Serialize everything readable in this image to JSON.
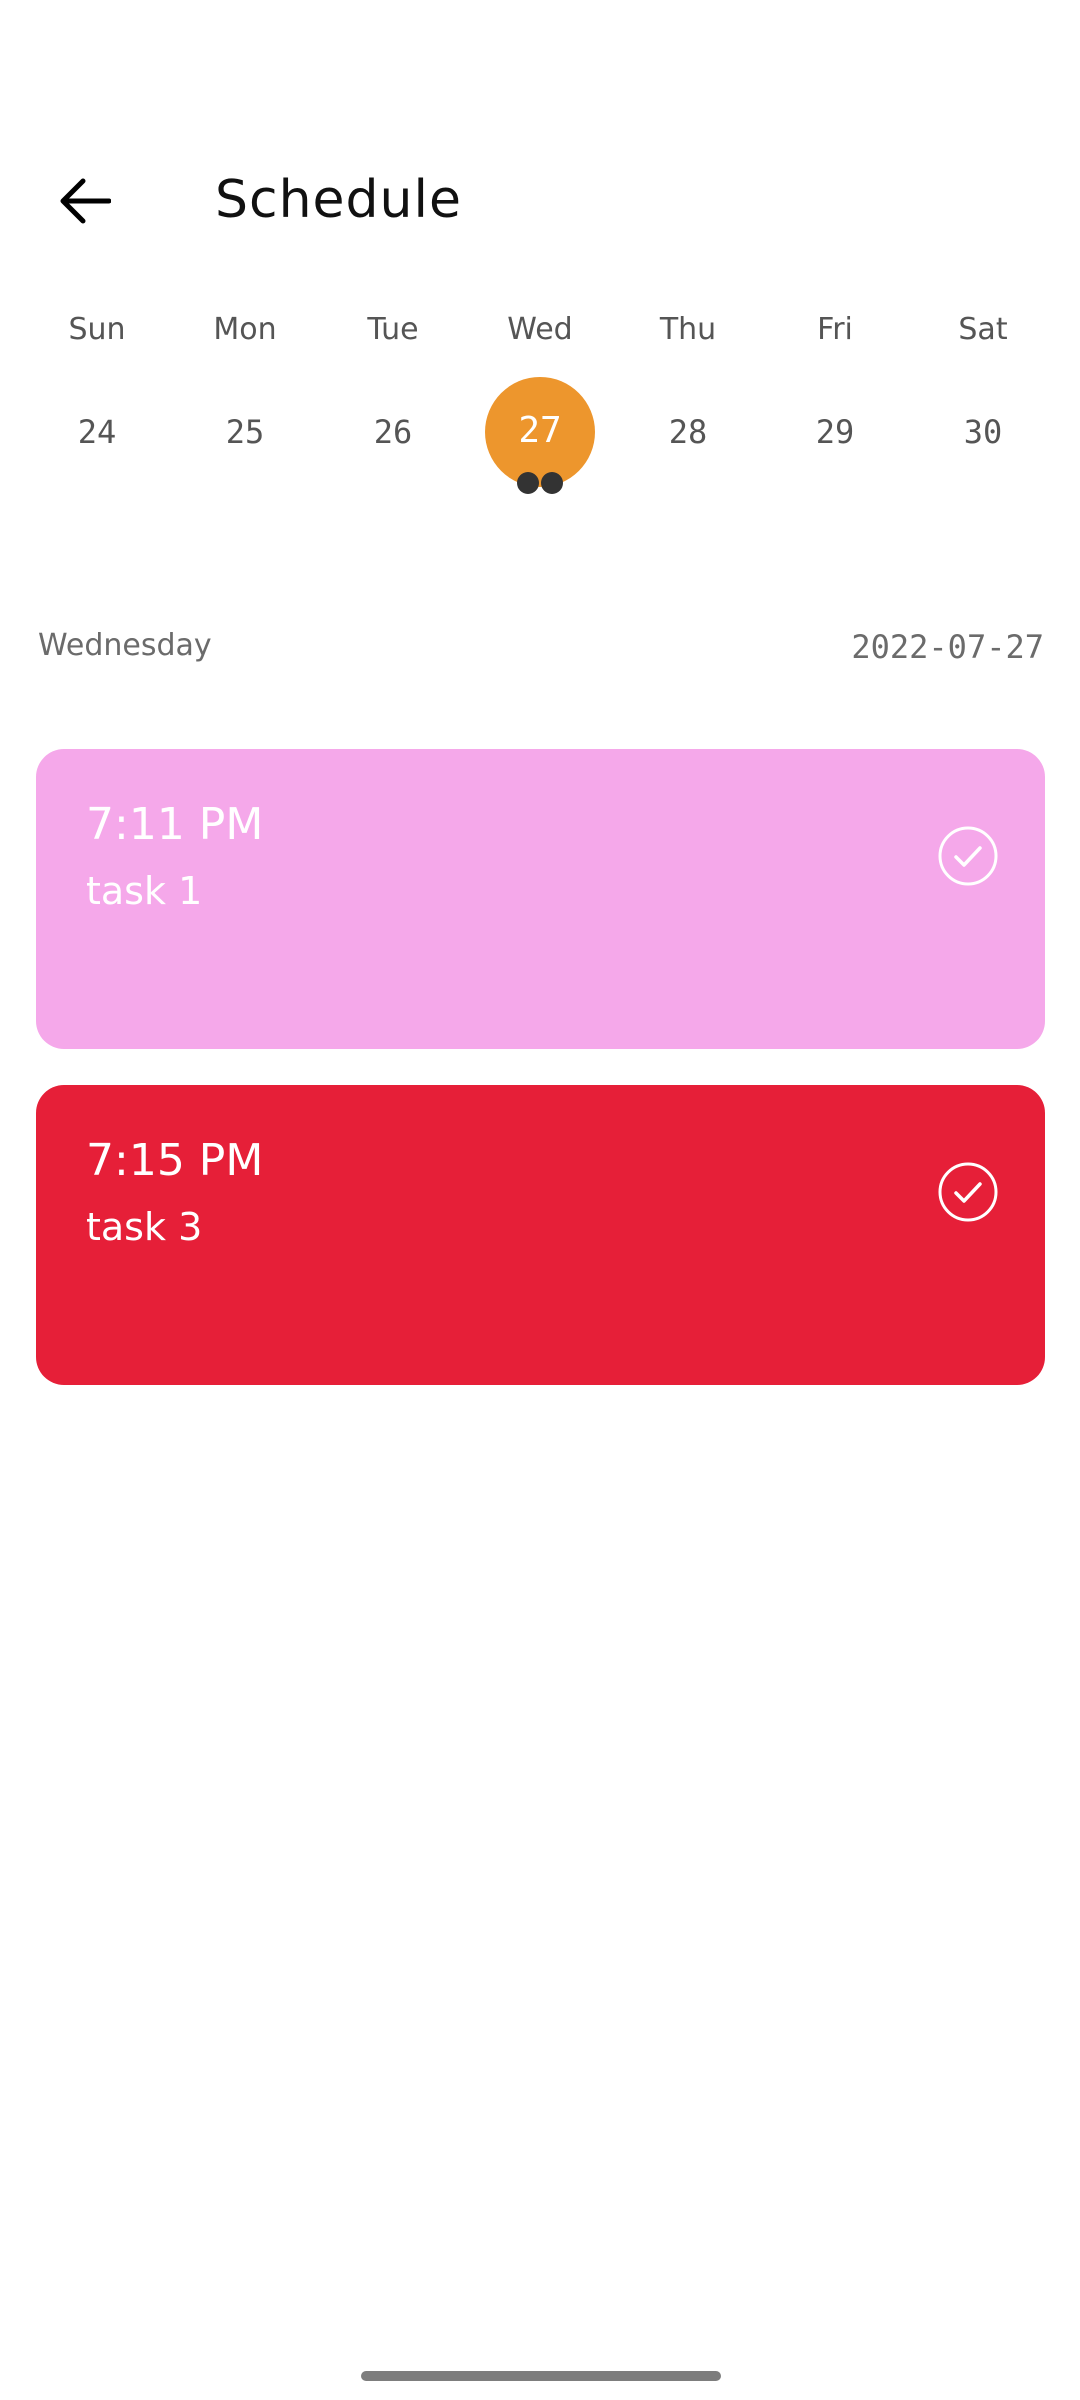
{
  "app_bar": {
    "back_icon": "arrow-left-icon",
    "title": "Schedule"
  },
  "week": {
    "days": [
      {
        "name": "Sun",
        "num": "24"
      },
      {
        "name": "Mon",
        "num": "25"
      },
      {
        "name": "Tue",
        "num": "26"
      },
      {
        "name": "Wed",
        "num": "27",
        "selected": true,
        "task_dots": 2
      },
      {
        "name": "Thu",
        "num": "28"
      },
      {
        "name": "Fri",
        "num": "29"
      },
      {
        "name": "Sat",
        "num": "30"
      }
    ],
    "selected_color": "#ED962D"
  },
  "selected_date": {
    "weekday": "Wednesday",
    "date": "2022-07-27"
  },
  "tasks": [
    {
      "time": "7:11 PM",
      "title": "task 1",
      "color": "#F5A8EA",
      "check_icon": "check-circle-icon"
    },
    {
      "time": "7:15 PM",
      "title": "task 3",
      "color": "#E61F38",
      "check_icon": "check-circle-icon"
    }
  ]
}
